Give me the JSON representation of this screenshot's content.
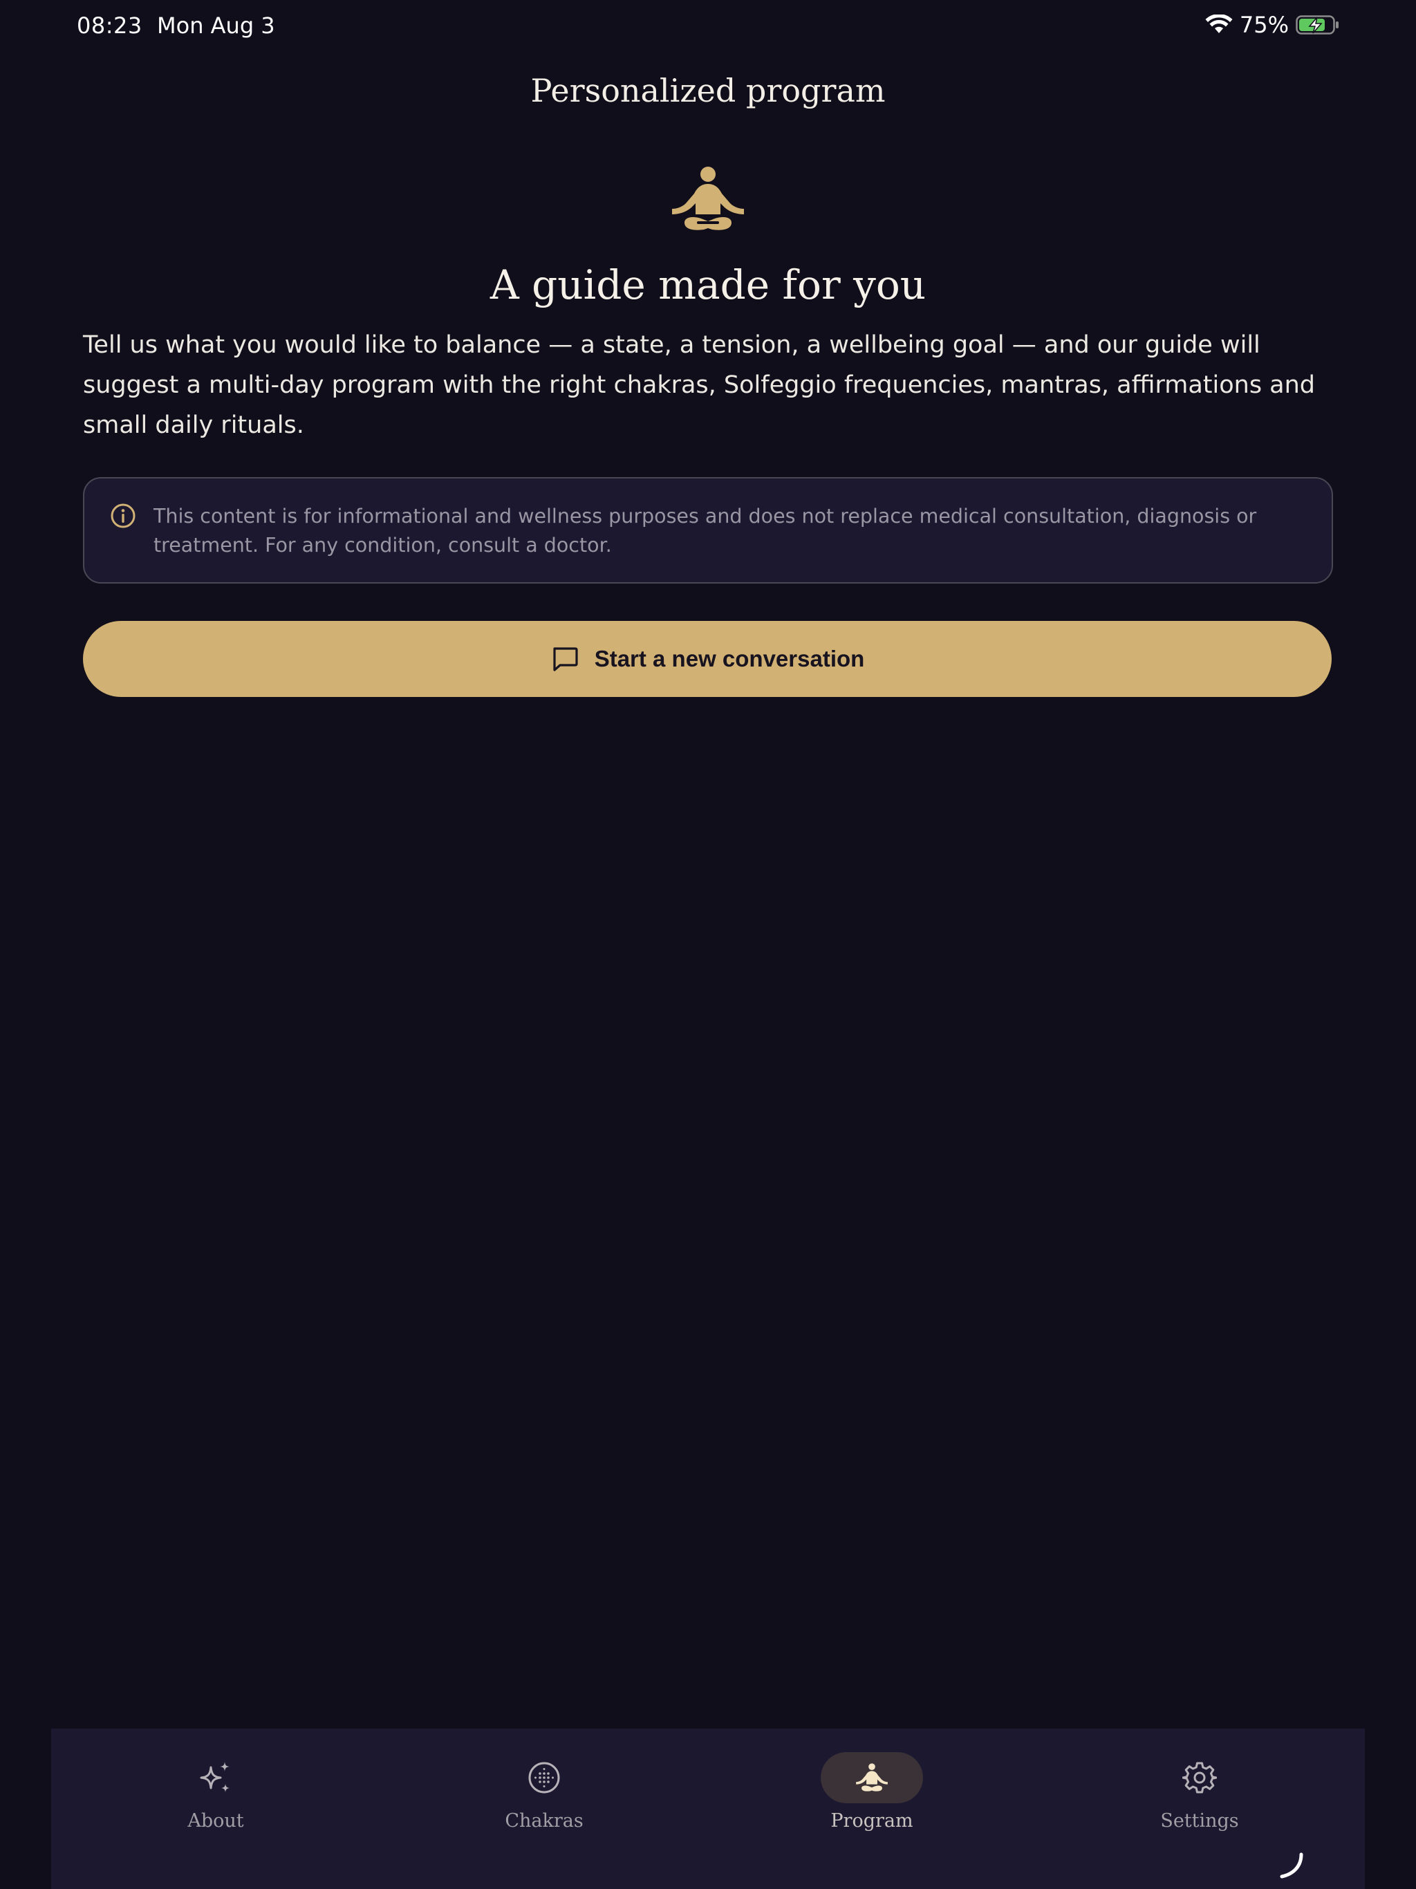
{
  "status_bar": {
    "time": "08:23",
    "date": "Mon Aug 3",
    "battery_percent": "75%",
    "wifi_icon": "wifi-icon",
    "battery_icon": "battery-charging-icon"
  },
  "header": {
    "title": "Personalized program"
  },
  "hero": {
    "icon": "meditation-icon",
    "heading": "A guide made for you",
    "description": "Tell us what you would like to balance — a state, a tension, a wellbeing goal — and our guide will suggest a multi-day program with the right chakras, Solfeggio frequencies, mantras, affirmations and small daily rituals."
  },
  "disclaimer": {
    "icon": "info-icon",
    "text": "This content is for informational and wellness purposes and does not replace medical consultation, diagnosis or treatment. For any condition, consult a doctor."
  },
  "cta": {
    "icon": "chat-bubble-icon",
    "label": "Start a new conversation"
  },
  "tab_bar": {
    "tabs": [
      {
        "label": "About",
        "icon": "sparkles-icon",
        "active": false
      },
      {
        "label": "Chakras",
        "icon": "chakra-circle-icon",
        "active": false
      },
      {
        "label": "Program",
        "icon": "meditation-icon",
        "active": true
      },
      {
        "label": "Settings",
        "icon": "gear-icon",
        "active": false
      }
    ]
  },
  "colors": {
    "background": "#110e1b",
    "surface": "#1c1830",
    "accent_gold": "#d2b274",
    "text_primary": "#f2eee6",
    "text_muted": "#9a96a4",
    "active_tab_pill": "#3a3237",
    "battery_green": "#5fc85f"
  }
}
